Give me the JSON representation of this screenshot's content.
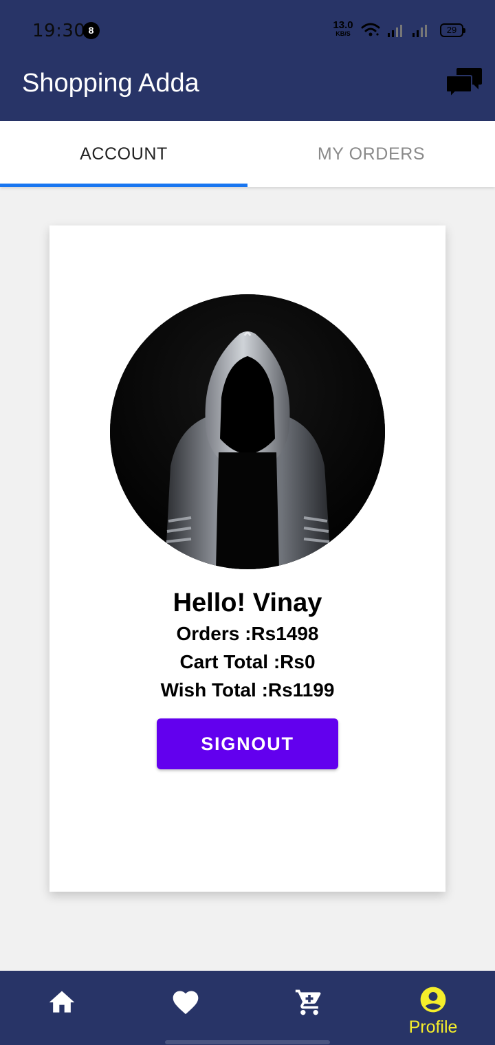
{
  "status_bar": {
    "time": "19:30",
    "notification_count": "8",
    "net_speed": "13.0",
    "net_unit": "KB/S",
    "battery": "29"
  },
  "app_bar": {
    "title": "Shopping Adda",
    "chat_icon": "chat-bubbles-icon"
  },
  "tabs": [
    {
      "label": "ACCOUNT",
      "selected": true
    },
    {
      "label": "MY ORDERS",
      "selected": false
    }
  ],
  "profile": {
    "greeting": "Hello! Vinay",
    "orders": "Orders :Rs1498",
    "cart_total": "Cart Total :Rs0",
    "wish_total": "Wish Total :Rs1199",
    "signout_label": "SIGNOUT"
  },
  "bottom_nav": {
    "items": [
      {
        "icon": "home-icon",
        "label": ""
      },
      {
        "icon": "heart-icon",
        "label": ""
      },
      {
        "icon": "cart-icon",
        "label": ""
      },
      {
        "icon": "profile-icon",
        "label": "Profile",
        "active": true
      }
    ]
  },
  "colors": {
    "primary": "#283467",
    "tab_indicator": "#1976f0",
    "button": "#6200ee",
    "nav_active": "#f5ee2b"
  }
}
